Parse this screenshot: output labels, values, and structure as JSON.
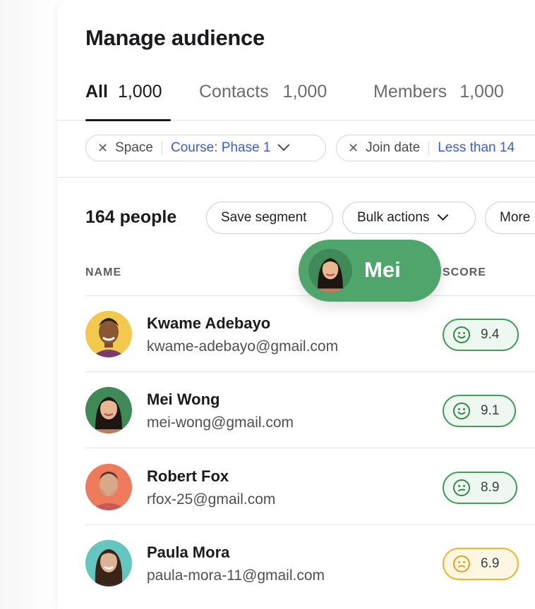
{
  "header": {
    "title": "Manage audience"
  },
  "tabs": [
    {
      "label": "All",
      "count": "1,000",
      "active": true
    },
    {
      "label": "Contacts",
      "count": "1,000",
      "active": false
    },
    {
      "label": "Members",
      "count": "1,000",
      "active": false
    }
  ],
  "filters": [
    {
      "key": "Space",
      "value": "Course: Phase 1"
    },
    {
      "key": "Join date",
      "value": "Less than 14"
    }
  ],
  "toolbar": {
    "people_count": "164 people",
    "save_segment": "Save segment",
    "bulk_actions": "Bulk actions",
    "more": "More"
  },
  "columns": {
    "name": "NAME",
    "score": "SCORE"
  },
  "cursor_label": {
    "name": "Mei"
  },
  "rows": [
    {
      "name": "Kwame Adebayo",
      "email": "kwame-adebayo@gmail.com",
      "score": "9.4",
      "mood": "happy",
      "avatar_bg": "#f2c94c"
    },
    {
      "name": "Mei Wong",
      "email": "mei-wong@gmail.com",
      "score": "9.1",
      "mood": "happy",
      "avatar_bg": "#3f8a57"
    },
    {
      "name": "Robert Fox",
      "email": "rfox-25@gmail.com",
      "score": "8.9",
      "mood": "neutral",
      "avatar_bg": "#ee7b5b"
    },
    {
      "name": "Paula Mora",
      "email": "paula-mora-11@gmail.com",
      "score": "6.9",
      "mood": "unsure",
      "avatar_bg": "#63c7c0"
    }
  ],
  "colors": {
    "accent_blue": "#3b5bdb",
    "score_green": "#3f9e5a",
    "score_yellow": "#f0b429",
    "bubble_green": "#4fa56c"
  }
}
